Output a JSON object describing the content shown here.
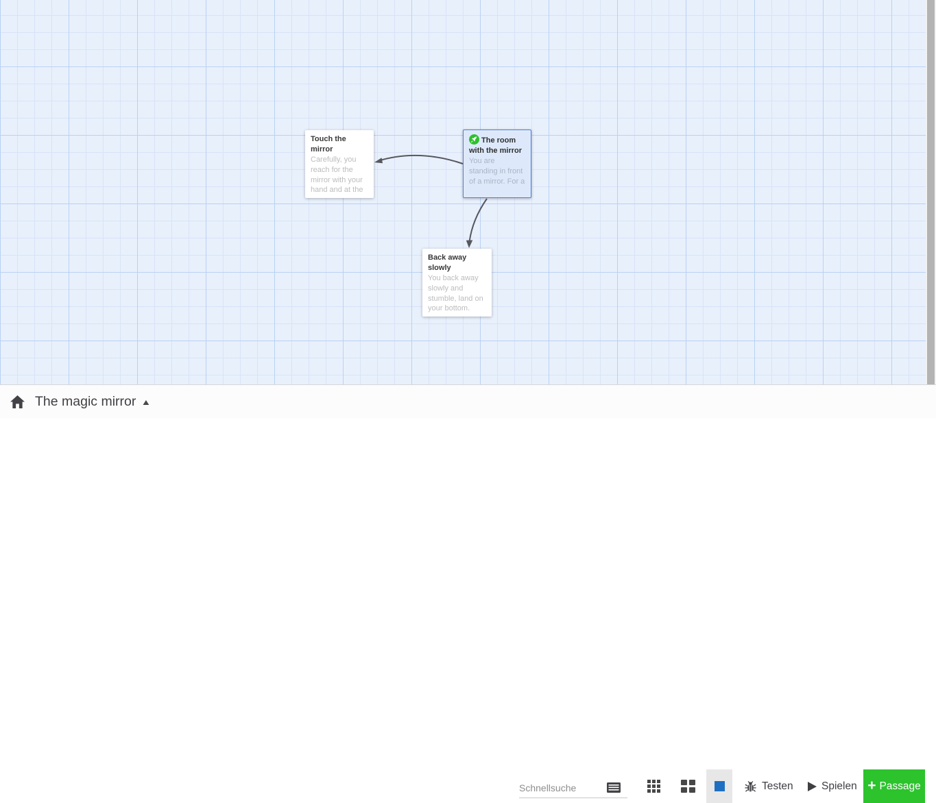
{
  "canvas": {
    "passages": [
      {
        "title": "Touch the mirror",
        "excerpt": "Carefully, you reach for the mirror with your hand and at the"
      },
      {
        "title": "The room with the mirror",
        "excerpt": "You are standing in front of a mirror. For a",
        "is_start": true,
        "selected": true
      },
      {
        "title": "Back away slowly",
        "excerpt": "You back away slowly and stumble, land on your bottom."
      }
    ],
    "links": [
      {
        "from": "The room with the mirror",
        "to": "Touch the mirror"
      },
      {
        "from": "The room with the mirror",
        "to": "Back away slowly"
      }
    ]
  },
  "toolbar": {
    "story_title": "The magic mirror",
    "caret_glyph": "▲",
    "search": {
      "placeholder": "Schnellsuche",
      "value": ""
    },
    "zoom_levels": [
      "smallest",
      "small",
      "medium",
      "large"
    ],
    "active_zoom": "large",
    "test_label": "Testen",
    "play_label": "Spielen",
    "plus_glyph": "+",
    "new_passage_label": "Passage"
  },
  "colors": {
    "grid_background": "#e8f0fc",
    "grid_line_minor": "#d8e3f8",
    "grid_line_major": "#b9d1f3",
    "selected_passage_border": "#5181cd",
    "selected_passage_background": "#dde9fb",
    "start_badge_green": "#2cc12c",
    "zoom_active_blue": "#1e6fc2",
    "new_passage_green": "#2cc32c",
    "arrow_gray": "#57575e"
  }
}
